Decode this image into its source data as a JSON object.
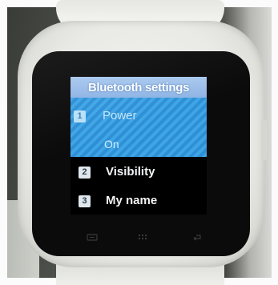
{
  "screen": {
    "title": "Bluetooth settings",
    "items": [
      {
        "number": "1",
        "label": "Power",
        "value": "On",
        "selected": true
      },
      {
        "number": "2",
        "label": "Visibility",
        "selected": false
      },
      {
        "number": "3",
        "label": "My name",
        "selected": false
      }
    ]
  },
  "softkeys": {
    "left_icon": "menu-icon",
    "center_icon": "apps-grid-icon",
    "right_icon": "back-icon"
  },
  "colors": {
    "title_bar": "#9dbfea",
    "selection": "#3fa6e6",
    "watch_body": "#ecece8"
  }
}
